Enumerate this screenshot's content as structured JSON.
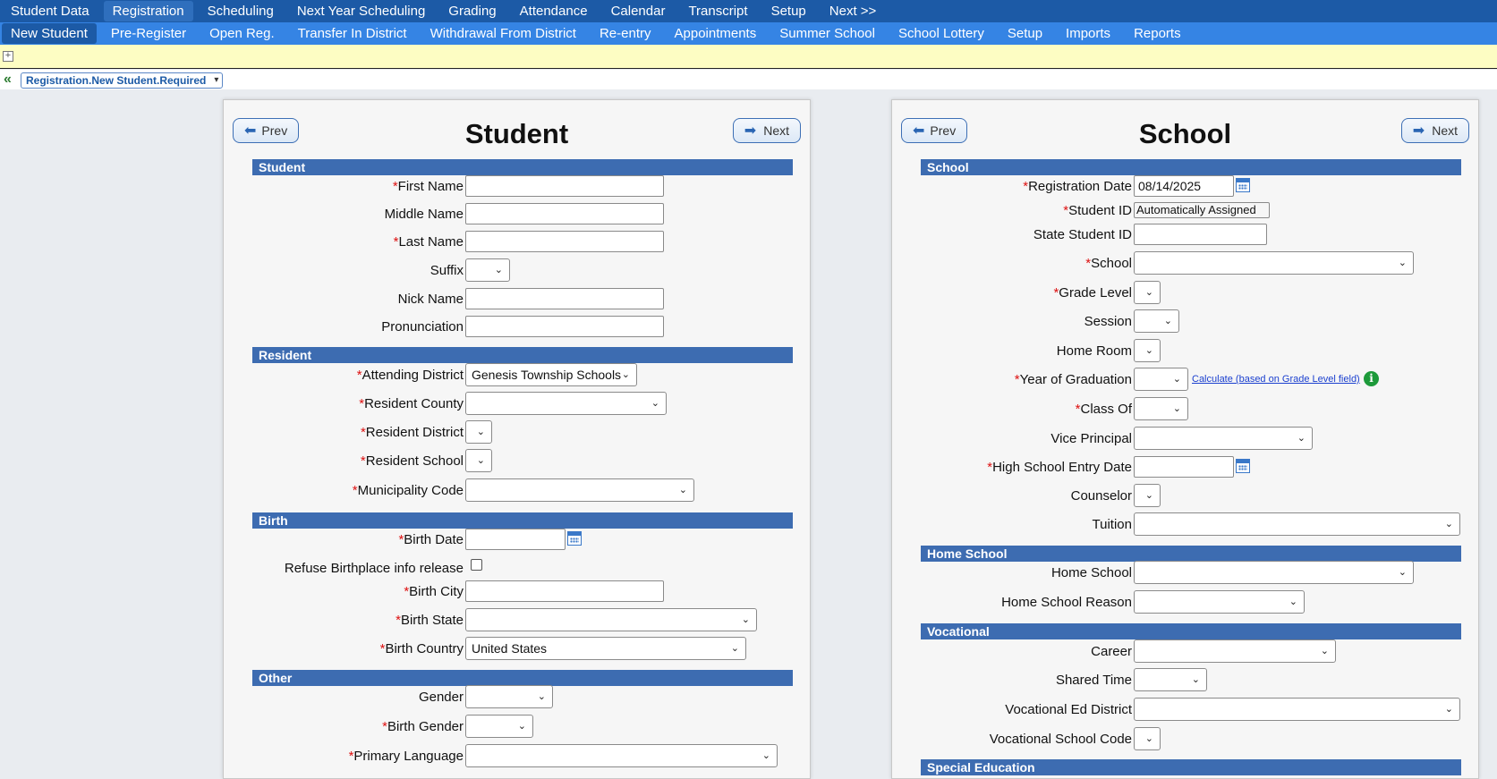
{
  "nav_primary": [
    "Student Data",
    "Registration",
    "Scheduling",
    "Next Year Scheduling",
    "Grading",
    "Attendance",
    "Calendar",
    "Transcript",
    "Setup",
    "Next >>"
  ],
  "nav_secondary": [
    "New Student",
    "Pre-Register",
    "Open Reg.",
    "Transfer In District",
    "Withdrawal From District",
    "Re-entry",
    "Appointments",
    "Summer School",
    "School Lottery",
    "Setup",
    "Imports",
    "Reports"
  ],
  "breadcrumb": "Registration.New Student.Required",
  "buttons": {
    "prev": "Prev",
    "next": "Next"
  },
  "student_panel": {
    "title": "Student",
    "sections": {
      "student": "Student",
      "resident": "Resident",
      "birth": "Birth",
      "other": "Other"
    },
    "fields": {
      "first_name": "First Name",
      "middle_name": "Middle Name",
      "last_name": "Last Name",
      "suffix": "Suffix",
      "nick_name": "Nick Name",
      "pronunciation": "Pronunciation",
      "attending_district": "Attending District",
      "attending_district_value": "Genesis Township Schools",
      "resident_county": "Resident County",
      "resident_district": "Resident District",
      "resident_school": "Resident School",
      "municipality_code": "Municipality Code",
      "birth_date": "Birth Date",
      "refuse_birthplace": "Refuse Birthplace info release",
      "birth_city": "Birth City",
      "birth_state": "Birth State",
      "birth_country": "Birth Country",
      "birth_country_value": "United States",
      "gender": "Gender",
      "birth_gender": "Birth Gender",
      "primary_language": "Primary Language"
    }
  },
  "school_panel": {
    "title": "School",
    "sections": {
      "school": "School",
      "home_school": "Home School",
      "vocational": "Vocational",
      "special_education": "Special Education"
    },
    "fields": {
      "registration_date": "Registration Date",
      "registration_date_value": "08/14/2025",
      "student_id": "Student ID",
      "student_id_value": "Automatically Assigned",
      "state_student_id": "State Student ID",
      "school": "School",
      "grade_level": "Grade Level",
      "session": "Session",
      "home_room": "Home Room",
      "year_of_graduation": "Year of Graduation",
      "calculate_link": "Calculate (based on Grade Level field)",
      "class_of": "Class Of",
      "vice_principal": "Vice Principal",
      "hs_entry_date": "High School Entry Date",
      "counselor": "Counselor",
      "tuition": "Tuition",
      "home_school": "Home School",
      "home_school_reason": "Home School Reason",
      "career": "Career",
      "shared_time": "Shared Time",
      "vocational_ed_district": "Vocational Ed District",
      "vocational_school_code": "Vocational School Code"
    }
  },
  "colors": {
    "nav_primary": "#1c5aa6",
    "nav_secondary": "#3584e4",
    "section_header": "#3d6cb1",
    "required": "#dd1111"
  }
}
